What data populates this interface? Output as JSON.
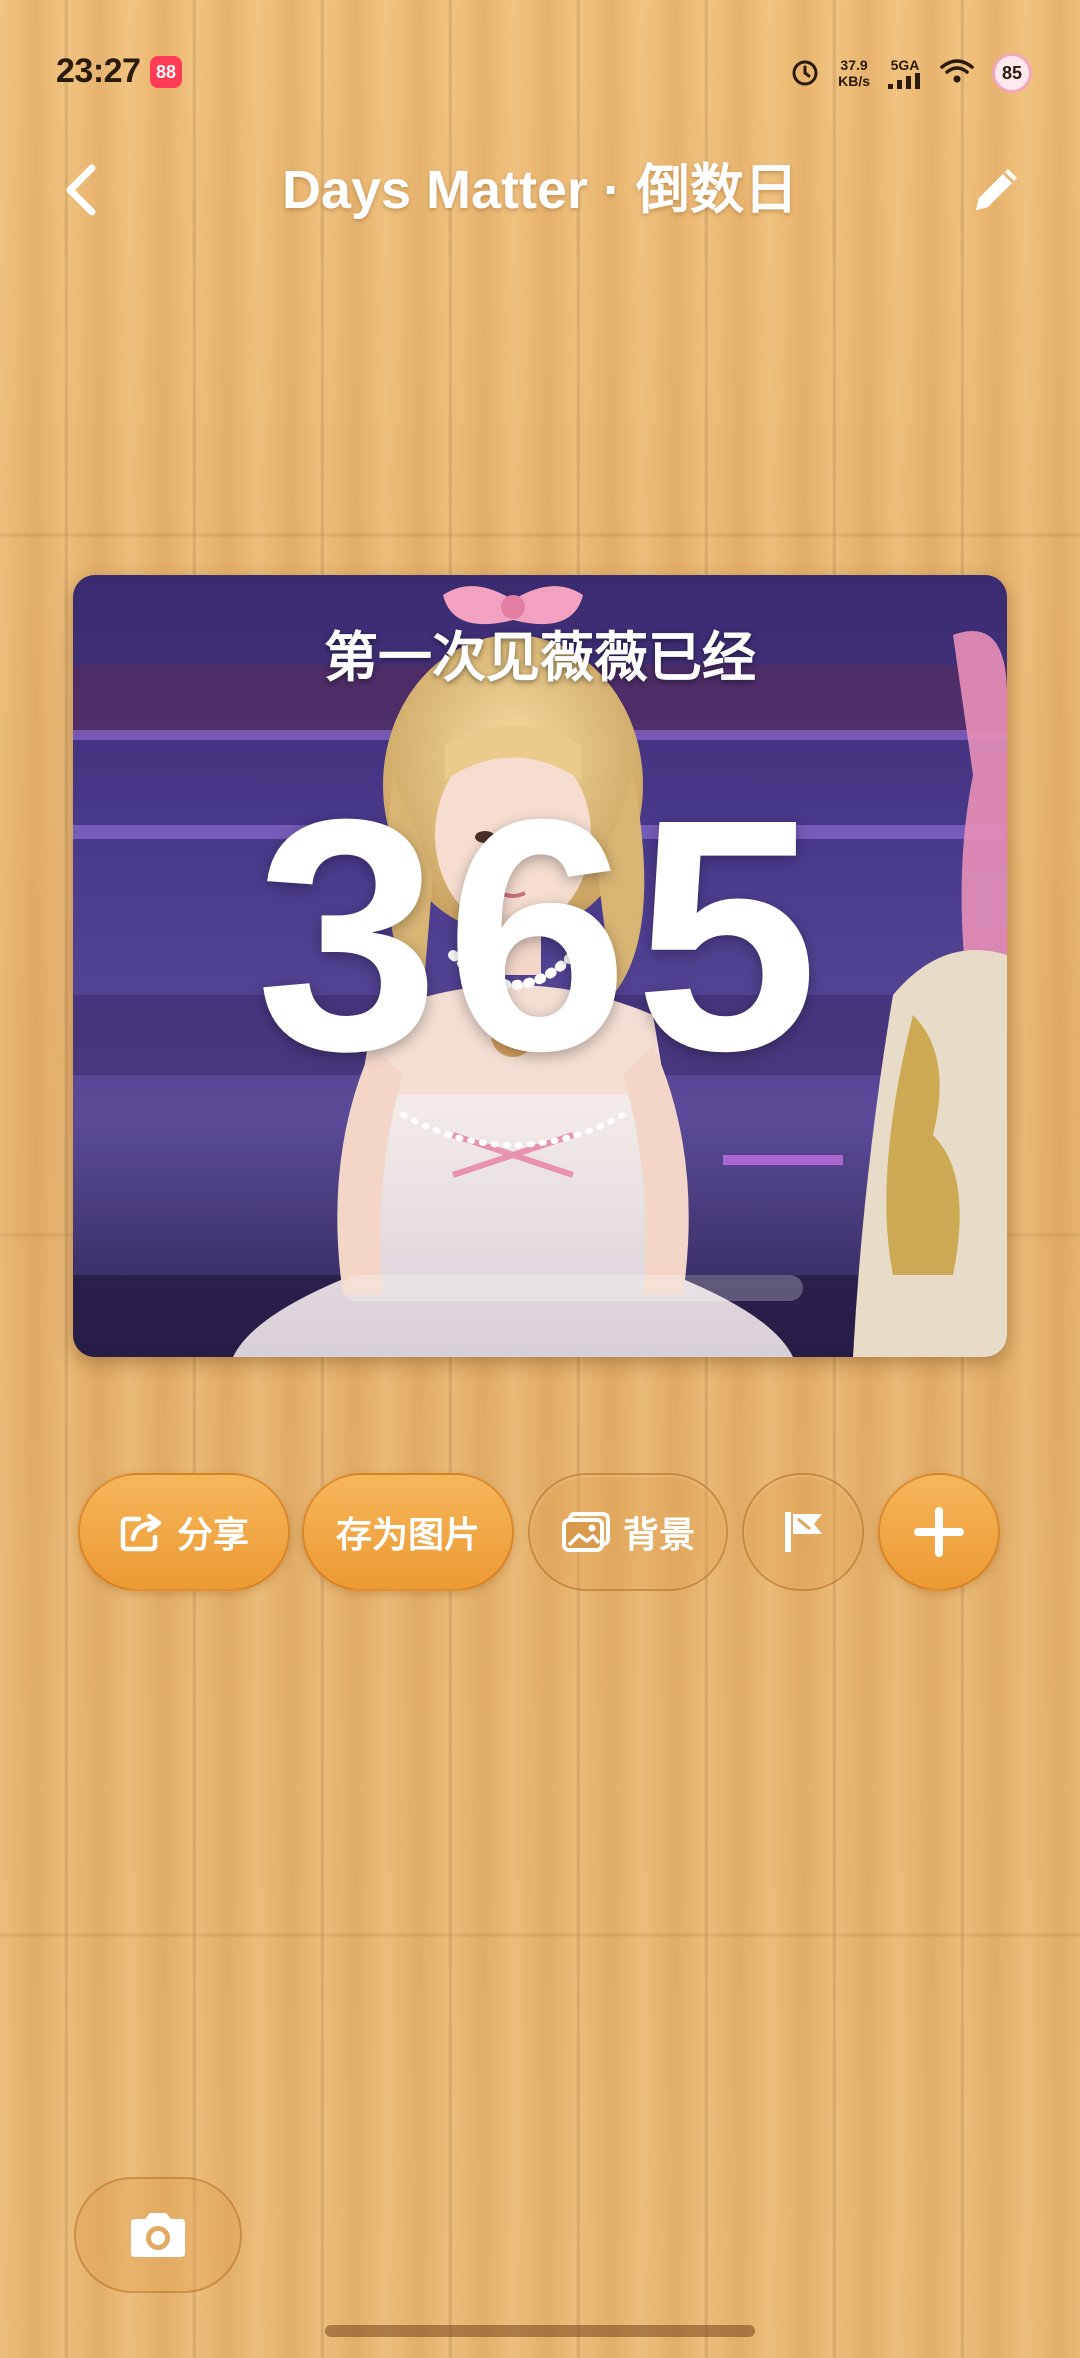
{
  "status_bar": {
    "time": "23:27",
    "app_badge": "88",
    "net_speed_value": "37.9",
    "net_speed_unit": "KB/s",
    "network_type": "5GA",
    "battery": "85"
  },
  "header": {
    "title": "Days Matter · 倒数日"
  },
  "card": {
    "event_title": "第一次见薇薇已经",
    "days_count": "365"
  },
  "actions": {
    "share_label": "分享",
    "save_image_label": "存为图片",
    "background_label": "背景"
  },
  "icons": {
    "back": "chevron-left-icon",
    "edit": "pencil-icon",
    "share": "share-icon",
    "background": "image-icon",
    "flag": "flag-icon",
    "add": "plus-icon",
    "camera": "camera-icon"
  },
  "colors": {
    "accent_orange": "#ee9e3a",
    "title_white": "#ffffff",
    "wood_base": "#e7b56f"
  }
}
